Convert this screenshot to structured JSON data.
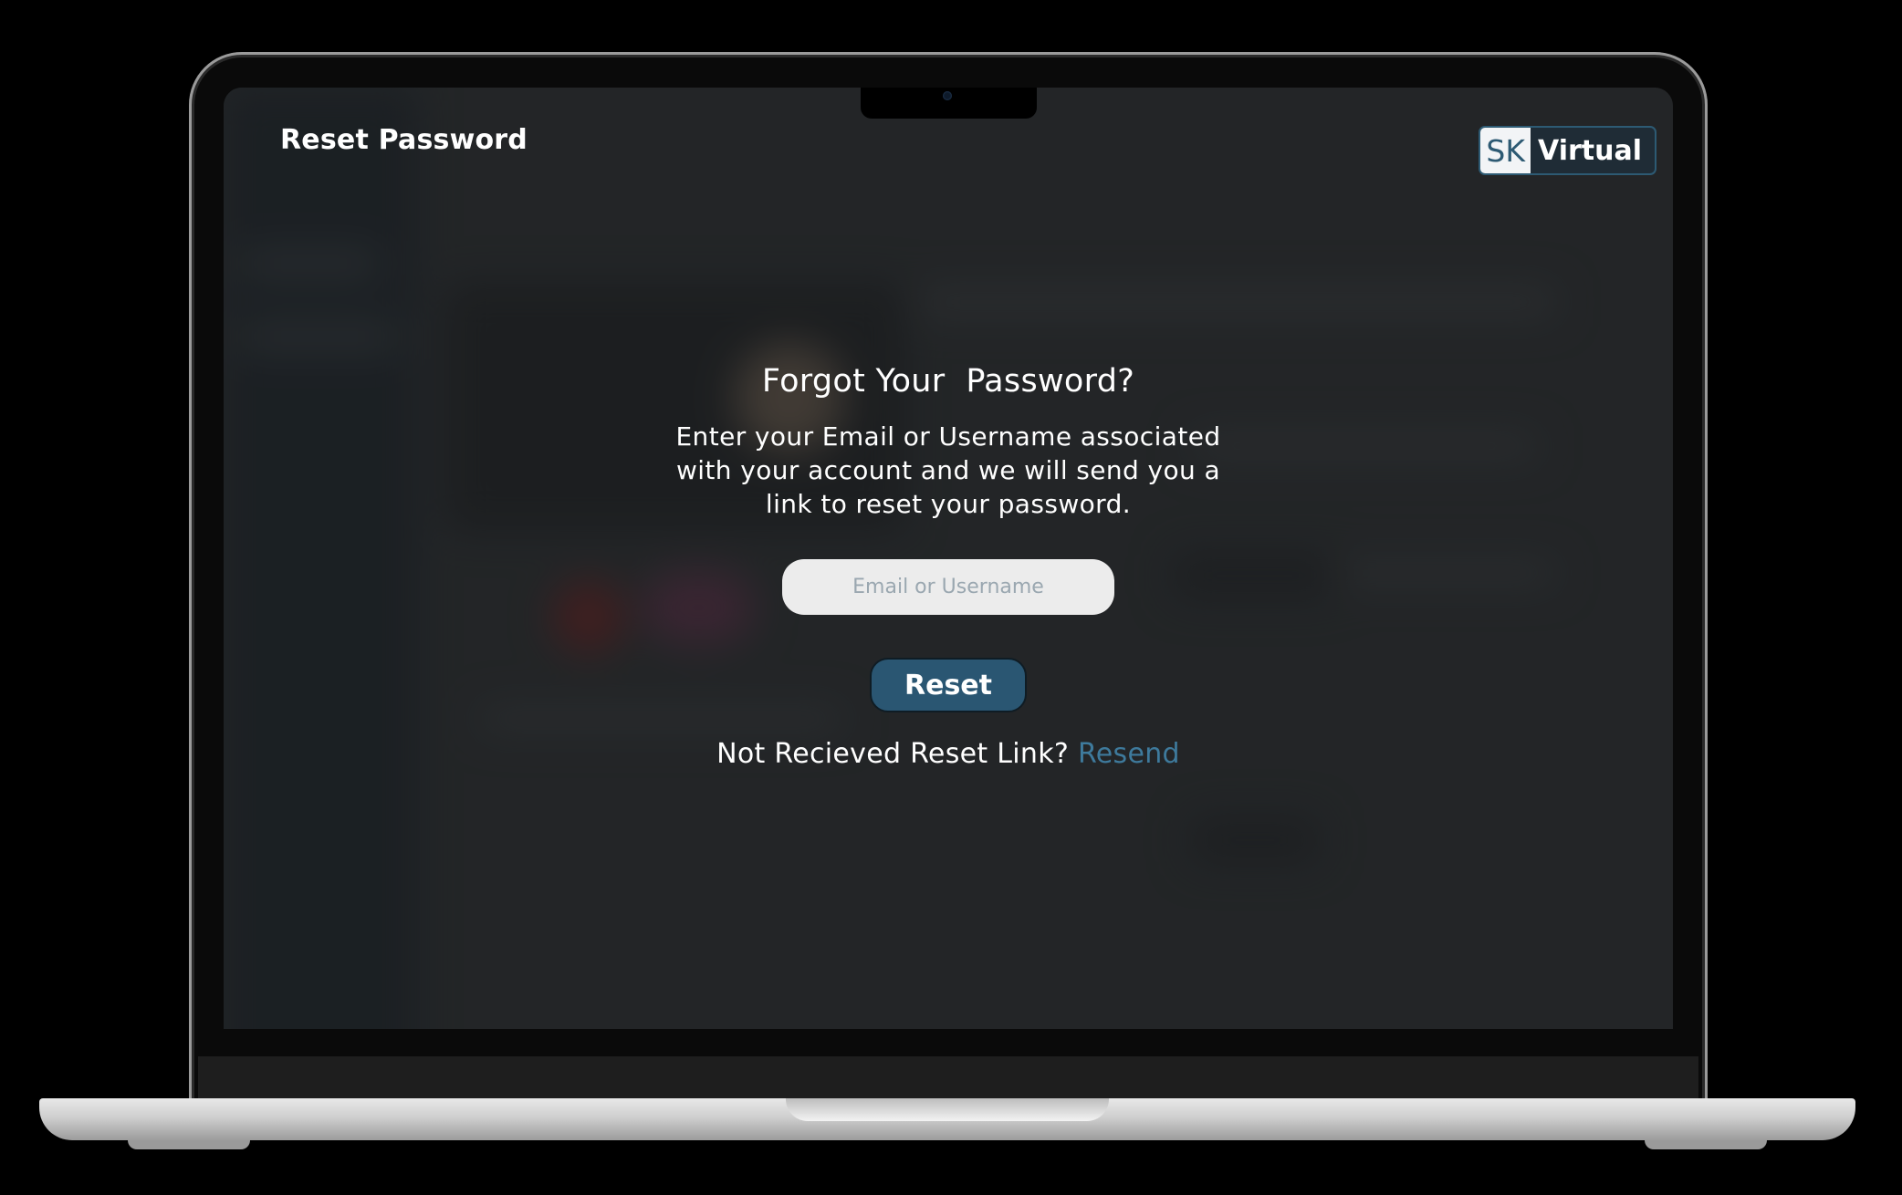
{
  "header": {
    "title": "Reset Password",
    "brand_sk": "SK",
    "brand_virtual": "Virtual"
  },
  "form": {
    "heading": "Forgot Your  Password?",
    "description": "Enter your Email or Username associated with your account and we will send you a link to reset your password.",
    "input_placeholder": "Email or Username",
    "input_value": "",
    "button_label": "Reset",
    "resend_prompt": "Not Recieved Reset Link?",
    "resend_link": "Resend"
  },
  "colors": {
    "accent": "#2a5672",
    "link": "#3e7a9c",
    "input_bg": "#ececec",
    "placeholder": "#9aa7b0"
  }
}
